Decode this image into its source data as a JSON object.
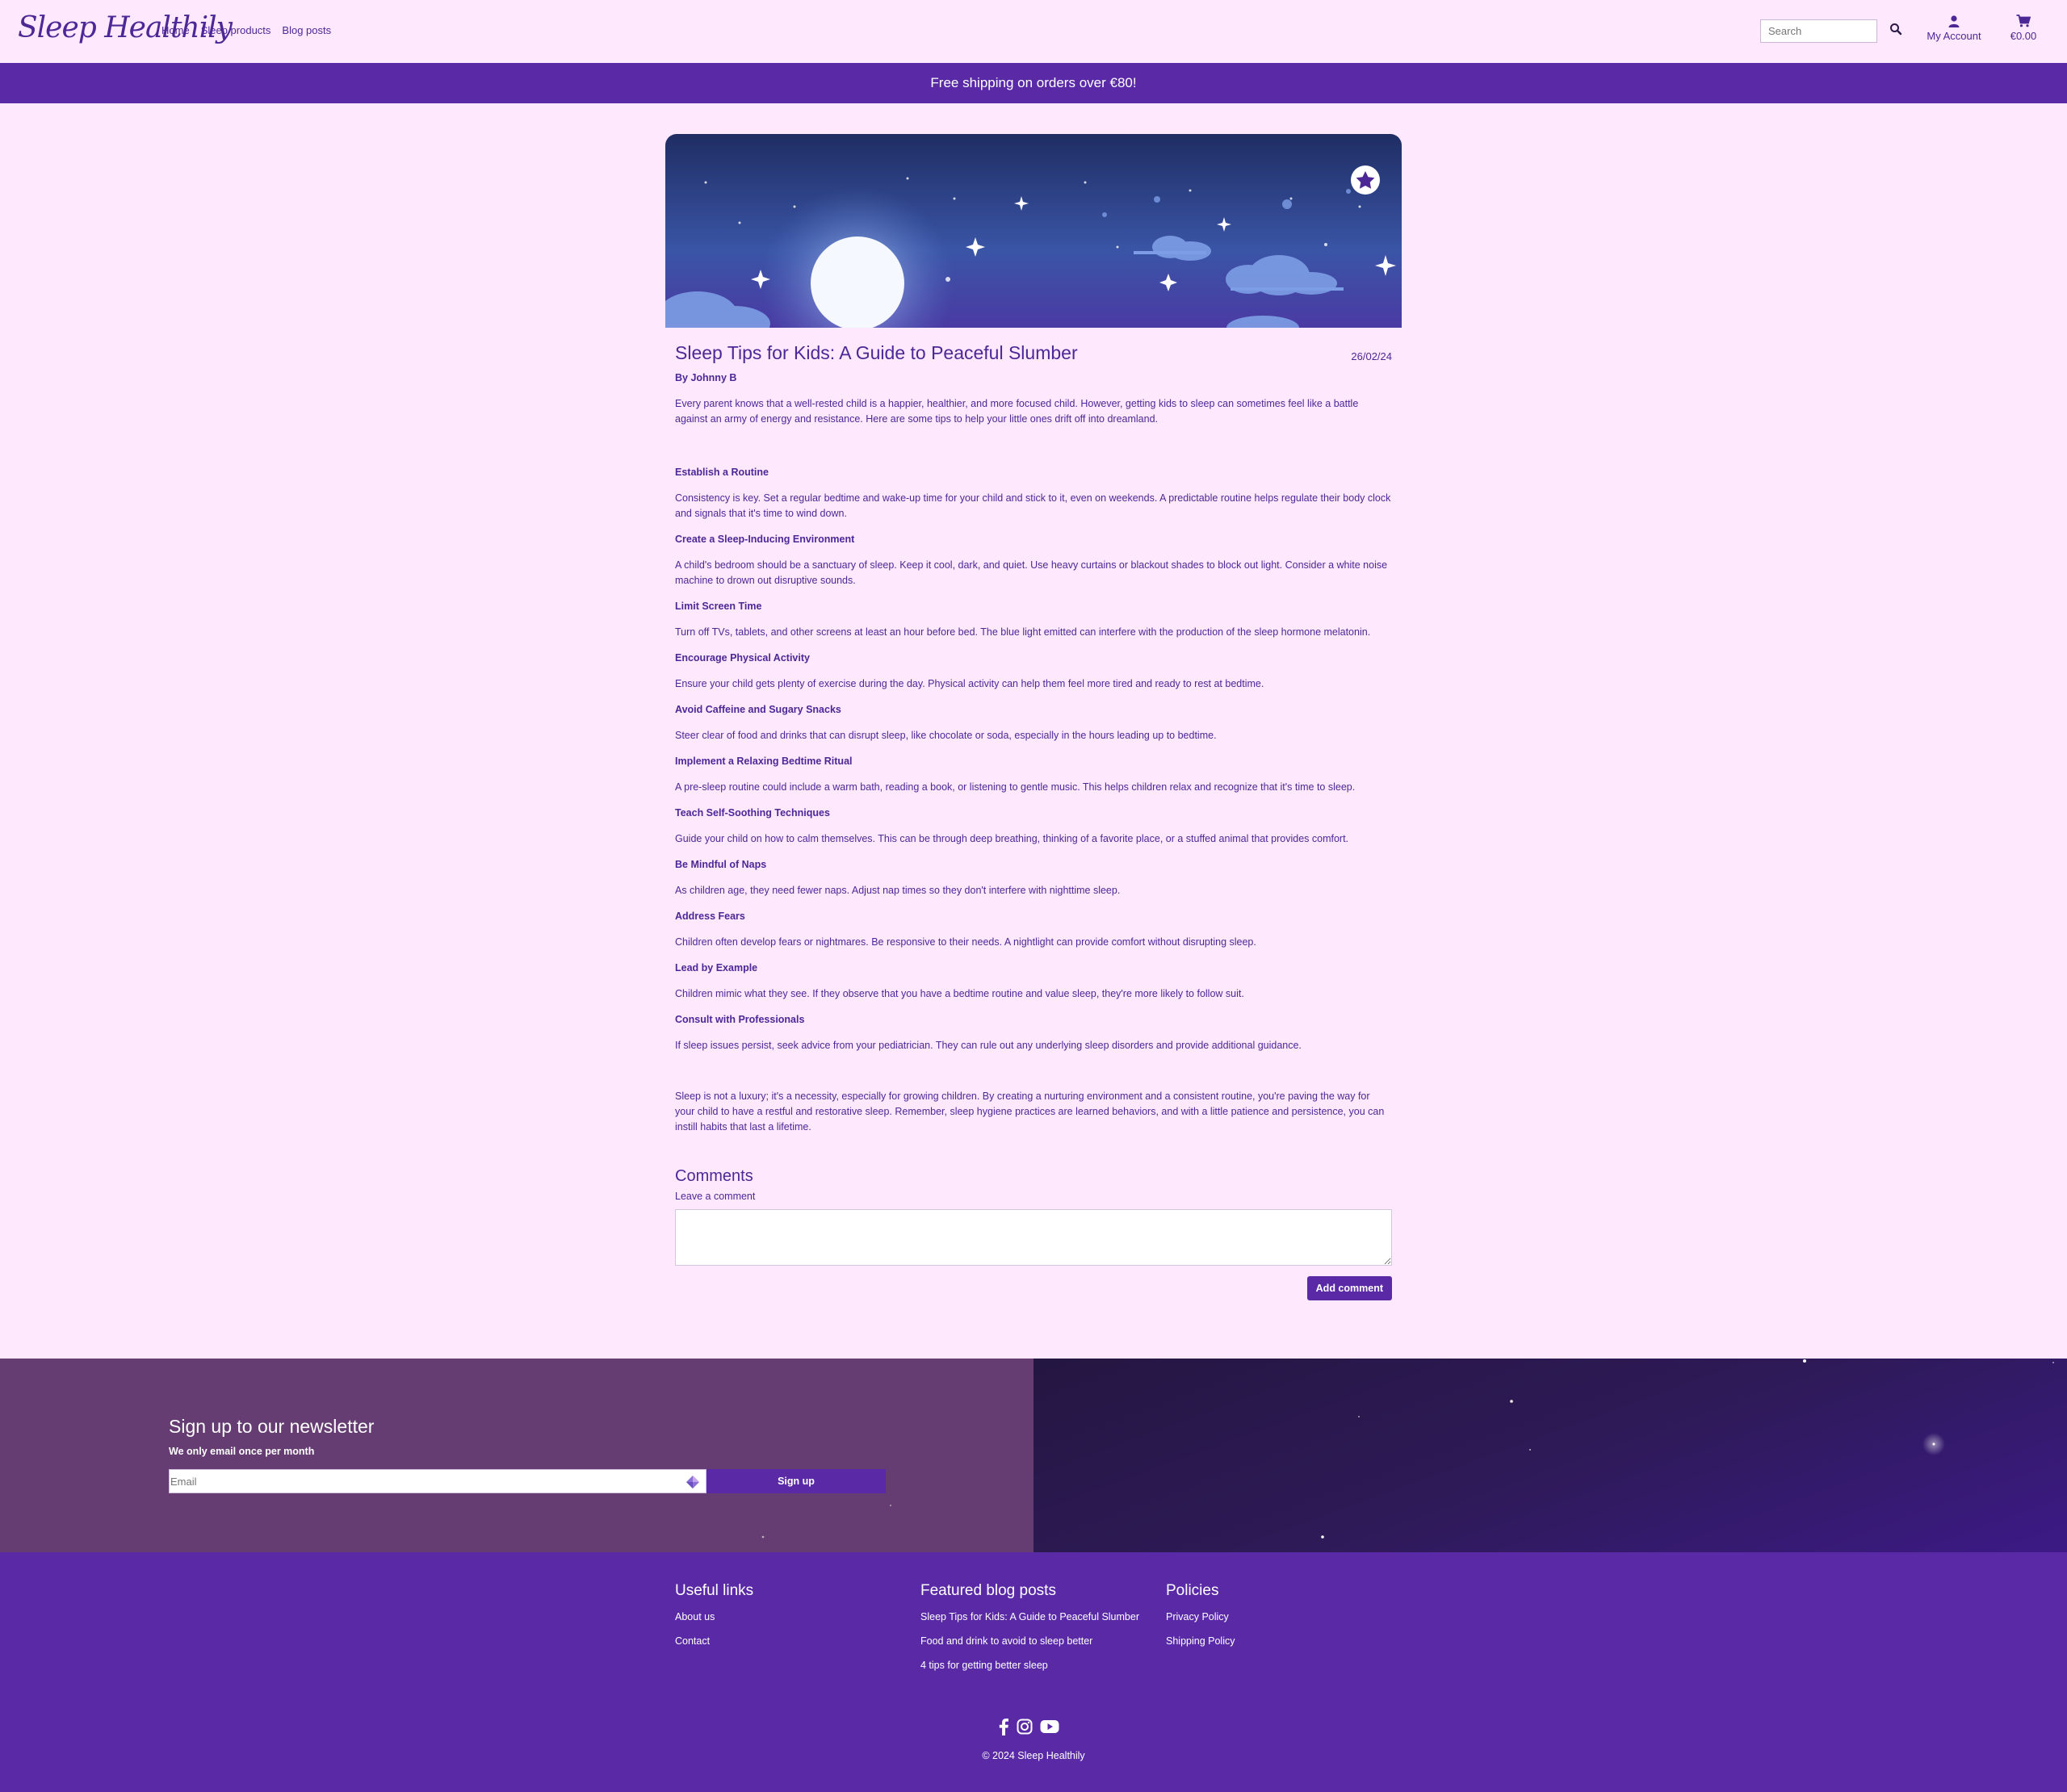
{
  "header": {
    "logo": "Sleep Healthily",
    "nav": [
      "Home",
      "Sleep products",
      "Blog posts"
    ],
    "search_placeholder": "Search",
    "account_label": "My Account",
    "cart_total": "€0.00"
  },
  "banner": {
    "text": "Free shipping on orders over €80!"
  },
  "article": {
    "title": "Sleep Tips for Kids: A Guide to Peaceful Slumber",
    "date": "26/02/24",
    "author": "By Johnny B",
    "intro": "Every parent knows that a well-rested child is a happier, healthier, and more focused child. However, getting kids to sleep can sometimes feel like a battle against an army of energy and resistance. Here are some tips to help your little ones drift off into dreamland.",
    "sections": [
      {
        "heading": "Establish a Routine",
        "text": "Consistency is key. Set a regular bedtime and wake-up time for your child and stick to it, even on weekends. A predictable routine helps regulate their body clock and signals that it's time to wind down."
      },
      {
        "heading": "Create a Sleep-Inducing Environment",
        "text": "A child's bedroom should be a sanctuary of sleep. Keep it cool, dark, and quiet. Use heavy curtains or blackout shades to block out light. Consider a white noise machine to drown out disruptive sounds."
      },
      {
        "heading": "Limit Screen Time",
        "text": "Turn off TVs, tablets, and other screens at least an hour before bed. The blue light emitted can interfere with the production of the sleep hormone melatonin."
      },
      {
        "heading": "Encourage Physical Activity",
        "text": "Ensure your child gets plenty of exercise during the day. Physical activity can help them feel more tired and ready to rest at bedtime."
      },
      {
        "heading": "Avoid Caffeine and Sugary Snacks",
        "text": "Steer clear of food and drinks that can disrupt sleep, like chocolate or soda, especially in the hours leading up to bedtime."
      },
      {
        "heading": "Implement a Relaxing Bedtime Ritual",
        "text": "A pre-sleep routine could include a warm bath, reading a book, or listening to gentle music. This helps children relax and recognize that it's time to sleep."
      },
      {
        "heading": "Teach Self-Soothing Techniques",
        "text": "Guide your child on how to calm themselves. This can be through deep breathing, thinking of a favorite place, or a stuffed animal that provides comfort."
      },
      {
        "heading": "Be Mindful of Naps",
        "text": "As children age, they need fewer naps. Adjust nap times so they don't interfere with nighttime sleep."
      },
      {
        "heading": "Address Fears",
        "text": "Children often develop fears or nightmares. Be responsive to their needs. A nightlight can provide comfort without disrupting sleep."
      },
      {
        "heading": "Lead by Example",
        "text": "Children mimic what they see. If they observe that you have a bedtime routine and value sleep, they're more likely to follow suit."
      },
      {
        "heading": "Consult with Professionals",
        "text": "If sleep issues persist, seek advice from your pediatrician. They can rule out any underlying sleep disorders and provide additional guidance."
      }
    ],
    "conclusion": "Sleep is not a luxury; it's a necessity, especially for growing children. By creating a nurturing environment and a consistent routine, you're paving the way for your child to have a restful and restorative sleep. Remember, sleep hygiene practices are learned behaviors, and with a little patience and persistence, you can instill habits that last a lifetime."
  },
  "comments": {
    "title": "Comments",
    "label": "Leave a comment",
    "button": "Add comment"
  },
  "newsletter": {
    "title": "Sign up to our newsletter",
    "subtitle": "We only email once per month",
    "email_placeholder": "Email",
    "button": "Sign up"
  },
  "footer": {
    "useful_links": {
      "title": "Useful links",
      "links": [
        "About us",
        "Contact"
      ]
    },
    "featured": {
      "title": "Featured blog posts",
      "links": [
        "Sleep Tips for Kids: A Guide to Peaceful Slumber",
        "Food and drink to avoid to sleep better",
        "4 tips for getting better sleep"
      ]
    },
    "policies": {
      "title": "Policies",
      "links": [
        "Privacy Policy",
        "Shipping Policy"
      ]
    },
    "social_icons": [
      "facebook-icon",
      "instagram-icon",
      "youtube-icon"
    ],
    "copyright": "© 2024 Sleep Healthily"
  },
  "colors": {
    "accent": "#5a2aa6",
    "background": "#fde8fd",
    "text": "#4b2896",
    "newsletter_bg": "#653d72"
  }
}
